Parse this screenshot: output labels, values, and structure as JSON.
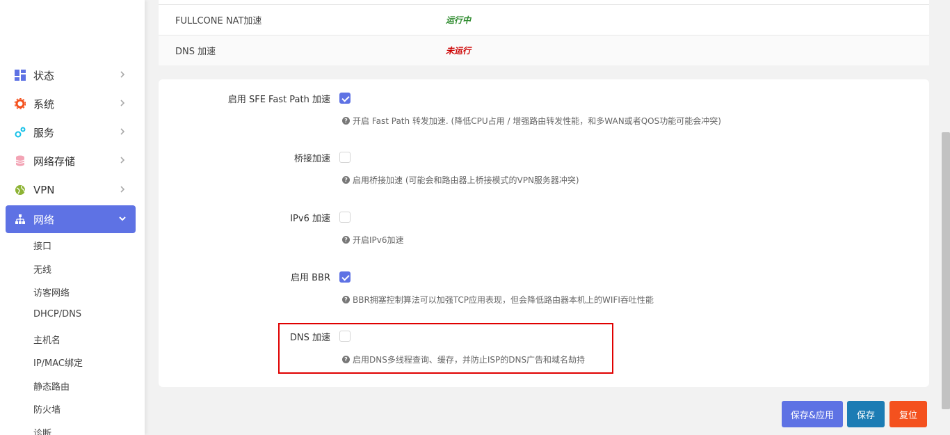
{
  "sidebar": {
    "items": [
      {
        "label": "状态",
        "icon": "dashboard-icon",
        "color": "#5e72e4"
      },
      {
        "label": "系统",
        "icon": "gear-icon",
        "color": "#f4511e"
      },
      {
        "label": "服务",
        "icon": "services-icon",
        "color": "#17c1e8"
      },
      {
        "label": "网络存储",
        "icon": "database-icon",
        "color": "#f3a4b5"
      },
      {
        "label": "VPN",
        "icon": "globe-icon",
        "color": "#8db334"
      },
      {
        "label": "网络",
        "icon": "network-icon",
        "color": "#ffffff"
      }
    ],
    "sub_items": [
      "接口",
      "无线",
      "访客网络",
      "DHCP/DNS",
      "主机名",
      "IP/MAC绑定",
      "静态路由",
      "防火墙",
      "诊断"
    ]
  },
  "status": {
    "rows": [
      {
        "label": "FULLCONE NAT加速",
        "value": "运行中",
        "color": "#2e8b2e"
      },
      {
        "label": "DNS 加速",
        "value": "未运行",
        "color": "#cc0000"
      }
    ]
  },
  "settings": {
    "options": [
      {
        "label": "启用 SFE Fast Path 加速",
        "checked": true,
        "hint": "开启 Fast Path 转发加速. (降低CPU占用 / 增强路由转发性能，和多WAN或者QOS功能可能会冲突)"
      },
      {
        "label": "桥接加速",
        "checked": false,
        "hint": "启用桥接加速 (可能会和路由器上桥接模式的VPN服务器冲突)"
      },
      {
        "label": "IPv6 加速",
        "checked": false,
        "hint": "开启IPv6加速"
      },
      {
        "label": "启用 BBR",
        "checked": true,
        "hint": "BBR拥塞控制算法可以加强TCP应用表现，但会降低路由器本机上的WIFI吞吐性能"
      },
      {
        "label": "DNS 加速",
        "checked": false,
        "hint": "启用DNS多线程查询、缓存，并防止ISP的DNS广告和域名劫持"
      }
    ],
    "hint_glyph": "?"
  },
  "buttons": {
    "save_apply": "保存&应用",
    "save": "保存",
    "reset": "复位"
  }
}
